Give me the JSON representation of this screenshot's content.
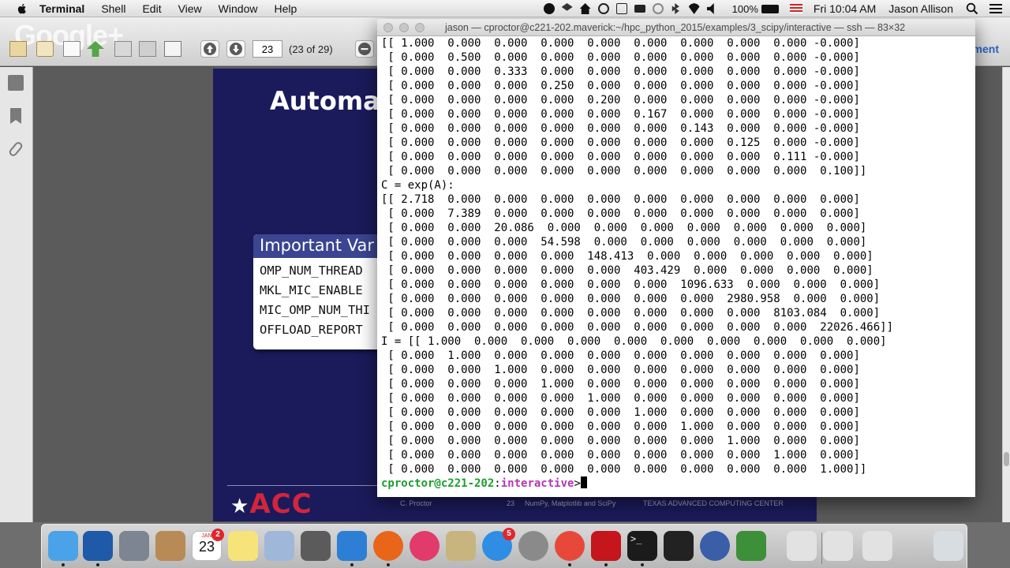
{
  "menubar": {
    "app_name": "Terminal",
    "menus": [
      "Shell",
      "Edit",
      "View",
      "Window",
      "Help"
    ],
    "battery_percent": "100%",
    "clock": "Fri 10:04 AM",
    "user": "Jason Allison"
  },
  "pdf_viewer": {
    "page_number": "23",
    "page_count": "(23 of 29)",
    "right_label": "ment",
    "watermark": "Google+"
  },
  "slide": {
    "title": "Automat",
    "box_header": "Important Var",
    "box_items": [
      "OMP_NUM_THREAD",
      "MKL_MIC_ENABLE",
      "MIC_OMP_NUM_THI",
      "OFFLOAD_REPORT"
    ],
    "logo_text": "ACC",
    "footer_author": "C. Proctor",
    "footer_page": "23",
    "footer_title": "NumPy, Matplotlib and SciPy",
    "footer_center": "TEXAS ADVANCED COMPUTING CENTER"
  },
  "terminal": {
    "title": "jason — cproctor@c221-202.maverick:~/hpc_python_2015/examples/3_scipy/interactive — ssh — 83×32",
    "lines": [
      "[[ 1.000  0.000  0.000  0.000  0.000  0.000  0.000  0.000  0.000 -0.000]",
      " [ 0.000  0.500  0.000  0.000  0.000  0.000  0.000  0.000  0.000 -0.000]",
      " [ 0.000  0.000  0.333  0.000  0.000  0.000  0.000  0.000  0.000 -0.000]",
      " [ 0.000  0.000  0.000  0.250  0.000  0.000  0.000  0.000  0.000 -0.000]",
      " [ 0.000  0.000  0.000  0.000  0.200  0.000  0.000  0.000  0.000 -0.000]",
      " [ 0.000  0.000  0.000  0.000  0.000  0.167  0.000  0.000  0.000 -0.000]",
      " [ 0.000  0.000  0.000  0.000  0.000  0.000  0.143  0.000  0.000 -0.000]",
      " [ 0.000  0.000  0.000  0.000  0.000  0.000  0.000  0.125  0.000 -0.000]",
      " [ 0.000  0.000  0.000  0.000  0.000  0.000  0.000  0.000  0.111 -0.000]",
      " [ 0.000  0.000  0.000  0.000  0.000  0.000  0.000  0.000  0.000  0.100]]",
      "C = exp(A):",
      "[[ 2.718  0.000  0.000  0.000  0.000  0.000  0.000  0.000  0.000  0.000]",
      " [ 0.000  7.389  0.000  0.000  0.000  0.000  0.000  0.000  0.000  0.000]",
      " [ 0.000  0.000  20.086  0.000  0.000  0.000  0.000  0.000  0.000  0.000]",
      " [ 0.000  0.000  0.000  54.598  0.000  0.000  0.000  0.000  0.000  0.000]",
      " [ 0.000  0.000  0.000  0.000  148.413  0.000  0.000  0.000  0.000  0.000]",
      " [ 0.000  0.000  0.000  0.000  0.000  403.429  0.000  0.000  0.000  0.000]",
      " [ 0.000  0.000  0.000  0.000  0.000  0.000  1096.633  0.000  0.000  0.000]",
      " [ 0.000  0.000  0.000  0.000  0.000  0.000  0.000  2980.958  0.000  0.000]",
      " [ 0.000  0.000  0.000  0.000  0.000  0.000  0.000  0.000  8103.084  0.000]",
      " [ 0.000  0.000  0.000  0.000  0.000  0.000  0.000  0.000  0.000  22026.466]]",
      "I = [[ 1.000  0.000  0.000  0.000  0.000  0.000  0.000  0.000  0.000  0.000]",
      " [ 0.000  1.000  0.000  0.000  0.000  0.000  0.000  0.000  0.000  0.000]",
      " [ 0.000  0.000  1.000  0.000  0.000  0.000  0.000  0.000  0.000  0.000]",
      " [ 0.000  0.000  0.000  1.000  0.000  0.000  0.000  0.000  0.000  0.000]",
      " [ 0.000  0.000  0.000  0.000  1.000  0.000  0.000  0.000  0.000  0.000]",
      " [ 0.000  0.000  0.000  0.000  0.000  1.000  0.000  0.000  0.000  0.000]",
      " [ 0.000  0.000  0.000  0.000  0.000  0.000  1.000  0.000  0.000  0.000]",
      " [ 0.000  0.000  0.000  0.000  0.000  0.000  0.000  1.000  0.000  0.000]",
      " [ 0.000  0.000  0.000  0.000  0.000  0.000  0.000  0.000  1.000  0.000]",
      " [ 0.000  0.000  0.000  0.000  0.000  0.000  0.000  0.000  0.000  1.000]]"
    ],
    "prompt_user": "cproctor@c221-202",
    "prompt_sep": ":",
    "prompt_dir": "interactive",
    "prompt_symbol": ">"
  },
  "dock": {
    "calendar_month": "JAN",
    "calendar_day": "23",
    "calendar_badge": "2",
    "appstore_badge": "5",
    "icons": [
      "finder-icon",
      "photo-booth-icon",
      "launchpad-icon",
      "contacts-icon",
      "calendar-icon",
      "notes-icon",
      "preview-icon",
      "camera-icon",
      "xcode-icon",
      "firefox-icon",
      "itunes-icon",
      "script-icon",
      "app-store-icon",
      "system-preferences-icon",
      "chrome-icon",
      "acrobat-icon",
      "terminal-icon",
      "x11-icon",
      "stopwatch-icon",
      "charts-icon",
      "document-icon",
      "pdf-doc-icon",
      "pdf-doc2-icon",
      "trash-icon"
    ],
    "colors": [
      "#4aa3e8",
      "#1e5aa8",
      "#7c8591",
      "#b88a55",
      "#ffffff",
      "#f6e37a",
      "#9fb7d8",
      "#5b5b5b",
      "#2d7fd6",
      "#e8651a",
      "#e23a6a",
      "#c7b47f",
      "#2f8de4",
      "#8a8a8a",
      "#e8483a",
      "#c4161c",
      "#1b1b1b",
      "#222222",
      "#3a5fa8",
      "#3d8f3a",
      "#e2e2e2",
      "#e2e2e2",
      "#e2e2e2",
      "#d8dde2"
    ]
  }
}
